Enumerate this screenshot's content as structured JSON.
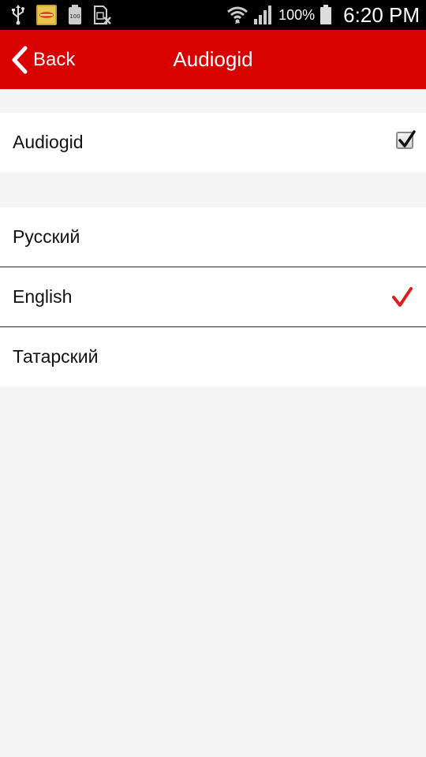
{
  "status_bar": {
    "battery_percent": "100%",
    "time": "6:20 PM",
    "icons": [
      "usb-icon",
      "app-notification-icon",
      "battery-100-notification-icon",
      "sim-missing-icon",
      "wifi-icon",
      "signal-icon",
      "battery-icon"
    ]
  },
  "header": {
    "back_label": "Back",
    "title": "Audiogid",
    "color": "#d90000"
  },
  "audiogid_toggle": {
    "label": "Audiogid",
    "checked": true
  },
  "languages": [
    {
      "label": "Русский",
      "selected": false
    },
    {
      "label": "English",
      "selected": true
    },
    {
      "label": "Татарский",
      "selected": false
    }
  ],
  "accent_color": "#e11b1b"
}
